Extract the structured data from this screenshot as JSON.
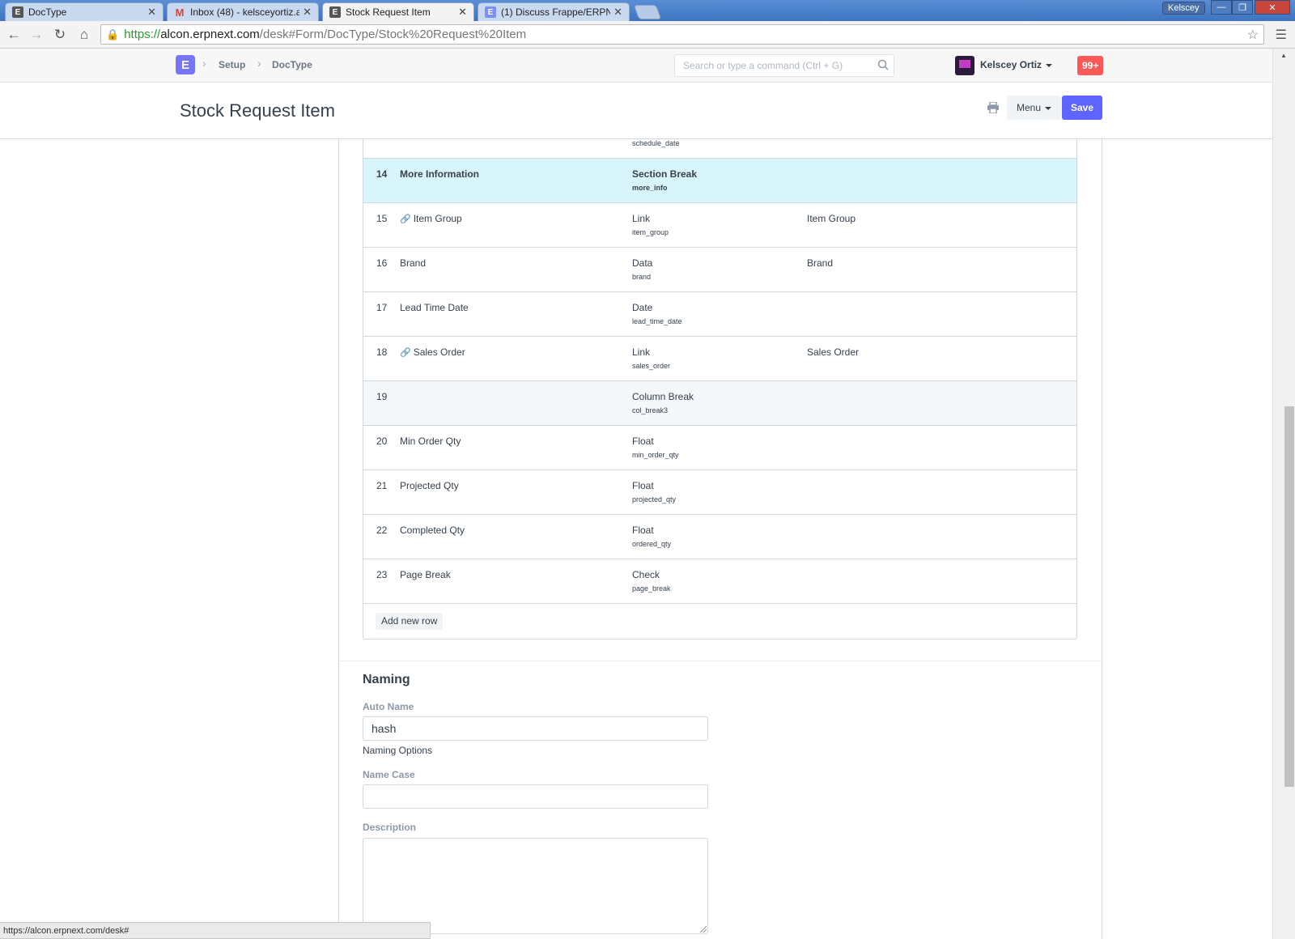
{
  "browser": {
    "tabs": [
      {
        "title": "DocType",
        "icon": "erpnext-favicon"
      },
      {
        "title": "Inbox (48) - kelsceyortiz.a",
        "icon": "gmail-favicon"
      },
      {
        "title": "Stock Request Item",
        "icon": "erpnext-favicon",
        "active": true
      },
      {
        "title": "(1) Discuss Frappe/ERPNe",
        "icon": "erpnext-favicon"
      }
    ],
    "close_glyph": "✕",
    "profile": "Kelscey",
    "url": {
      "scheme": "https://",
      "host": "alcon.erpnext.com",
      "path": "/desk#Form/DocType/Stock%20Request%20Item"
    },
    "status_url": "https://alcon.erpnext.com/desk#"
  },
  "navbar": {
    "logo": "E",
    "breadcrumbs": [
      "Setup",
      "DocType"
    ],
    "search_placeholder": "Search or type a command (Ctrl + G)",
    "user": "Kelscey Ortiz",
    "notifications": "99+"
  },
  "page": {
    "title": "Stock Request Item",
    "menu_label": "Menu",
    "save_label": "Save"
  },
  "fields_grid": {
    "stub_fieldname": "schedule_date",
    "rows": [
      {
        "idx": "14",
        "label": "More Information",
        "type": "Section Break",
        "fieldname": "more_info",
        "options": "",
        "link": false,
        "style": "highlight"
      },
      {
        "idx": "15",
        "label": "Item Group",
        "type": "Link",
        "fieldname": "item_group",
        "options": "Item Group",
        "link": true,
        "style": ""
      },
      {
        "idx": "16",
        "label": "Brand",
        "type": "Data",
        "fieldname": "brand",
        "options": "Brand",
        "link": false,
        "style": ""
      },
      {
        "idx": "17",
        "label": "Lead Time Date",
        "type": "Date",
        "fieldname": "lead_time_date",
        "options": "",
        "link": false,
        "style": ""
      },
      {
        "idx": "18",
        "label": "Sales Order",
        "type": "Link",
        "fieldname": "sales_order",
        "options": "Sales Order",
        "link": true,
        "style": ""
      },
      {
        "idx": "19",
        "label": "",
        "type": "Column Break",
        "fieldname": "col_break3",
        "options": "",
        "link": false,
        "style": "grey"
      },
      {
        "idx": "20",
        "label": "Min Order Qty",
        "type": "Float",
        "fieldname": "min_order_qty",
        "options": "",
        "link": false,
        "style": ""
      },
      {
        "idx": "21",
        "label": "Projected Qty",
        "type": "Float",
        "fieldname": "projected_qty",
        "options": "",
        "link": false,
        "style": ""
      },
      {
        "idx": "22",
        "label": "Completed Qty",
        "type": "Float",
        "fieldname": "ordered_qty",
        "options": "",
        "link": false,
        "style": ""
      },
      {
        "idx": "23",
        "label": "Page Break",
        "type": "Check",
        "fieldname": "page_break",
        "options": "",
        "link": false,
        "style": ""
      }
    ],
    "add_row_label": "Add new row"
  },
  "naming": {
    "section_title": "Naming",
    "autoname_label": "Auto Name",
    "autoname_value": "hash",
    "autoname_help": "Naming Options",
    "name_case_label": "Name Case",
    "name_case_value": "",
    "description_label": "Description"
  },
  "colors": {
    "primary": "#5e64ff",
    "highlight_row": "#d9f5fc",
    "notification": "#ff5858"
  }
}
